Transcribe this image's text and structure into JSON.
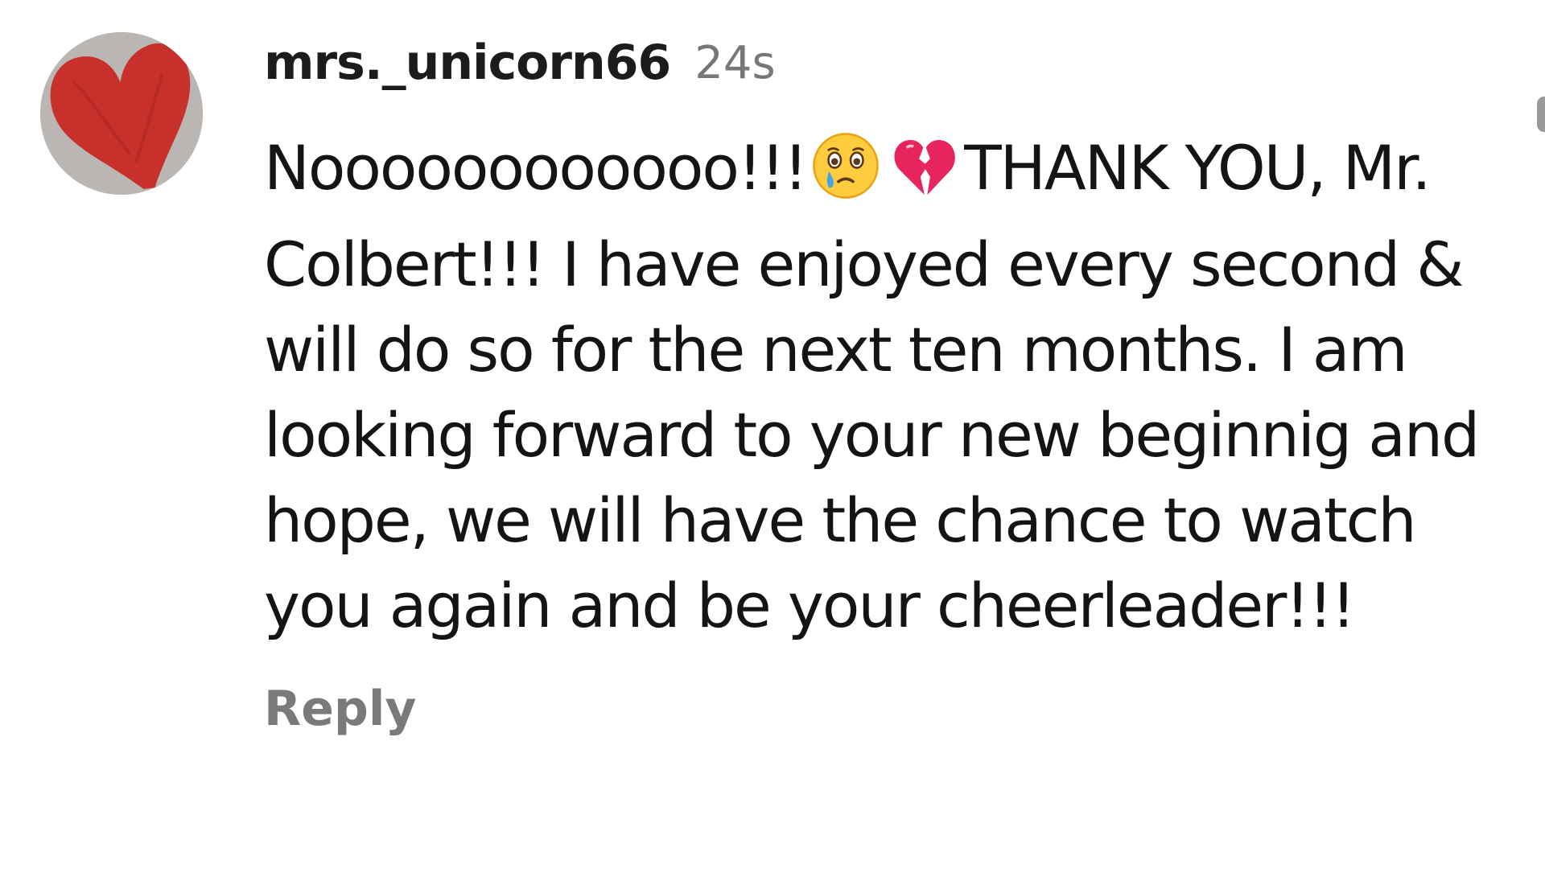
{
  "comment": {
    "username": "mrs._unicorn66",
    "timestamp": "24s",
    "text_part1": "Noooooooooooo!!!",
    "emoji1": "crying-face-icon",
    "emoji2": "broken-heart-icon",
    "text_part2": "THANK YOU, Mr. Colbert!!! I have enjoyed every second & will do so for the next ten months. I am looking forward to your new beginnig and hope, we will have the chance to watch you again and be your cheerleader!!!",
    "reply_label": "Reply"
  },
  "avatar": {
    "icon": "red-heart-drawing-icon",
    "background_color": "#b9b6b4",
    "heart_color": "#c8312b"
  },
  "colors": {
    "username": "#1c1c1c",
    "timestamp": "#777777",
    "text": "#141414",
    "reply": "#7a7a7a"
  }
}
